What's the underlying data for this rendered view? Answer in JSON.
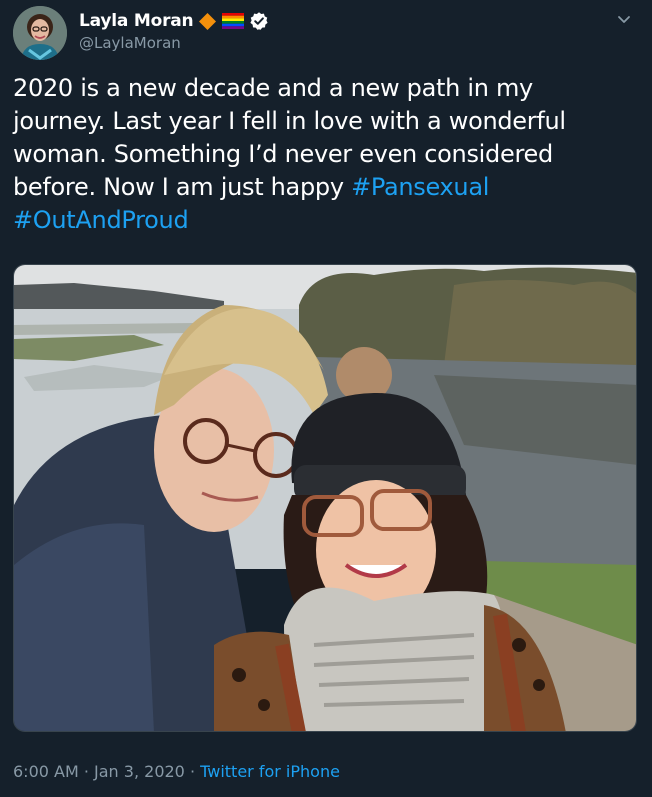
{
  "author": {
    "name": "Layla Moran",
    "handle": "@LaylaMoran"
  },
  "tweet": {
    "text_lines": [
      "2020 is a new decade and a new path in my",
      "journey. Last year I fell in love with a wonderful",
      "woman. Something I’d never even considered",
      "before. Now I am just happy "
    ],
    "hashtags": [
      "#Pansexual",
      "#OutAndProud"
    ]
  },
  "meta": {
    "time": "6:00 AM",
    "separator1": " · ",
    "date": "Jan 3, 2020",
    "separator2": " · ",
    "source": "Twitter for iPhone"
  },
  "icons": {
    "avatar": "user-avatar",
    "badge1": "orange-diamond-icon",
    "badge2": "rainbow-flag-icon",
    "badge3": "verified-icon",
    "menu": "chevron-down-icon"
  },
  "colors": {
    "background": "#15202b",
    "link": "#1da1f2",
    "muted": "#8899a6",
    "verified": "#ffffff"
  }
}
